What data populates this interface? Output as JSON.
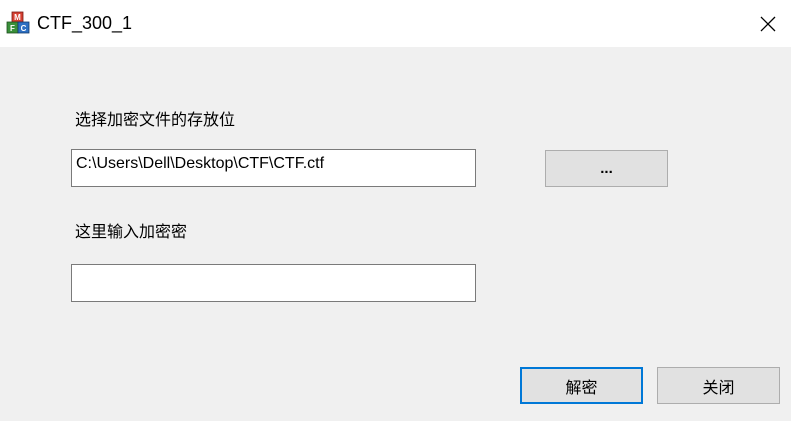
{
  "window": {
    "title": "CTF_300_1",
    "icons": {
      "app": "app-cubes-icon",
      "close": "close-icon"
    },
    "accent_color": "#1f6fb2"
  },
  "form": {
    "file_label": "选择加密文件的存放位",
    "file_path_value": "C:\\Users\\Dell\\Desktop\\CTF\\CTF.ctf",
    "browse_label": "...",
    "password_label": "这里输入加密密",
    "password_value": ""
  },
  "buttons": {
    "decrypt_label": "解密",
    "close_label": "关闭",
    "default_border_color": "#0078d7"
  }
}
